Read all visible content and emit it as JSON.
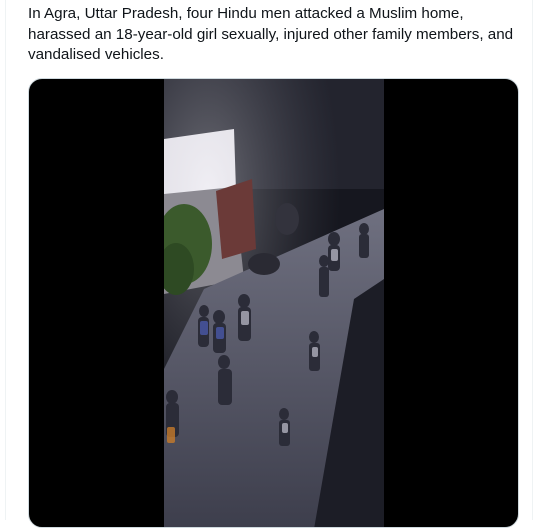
{
  "tweet": {
    "text": "In Agra, Uttar Pradesh, four Hindu men attacked a Muslim home, harassed an 18-year-old girl sexually, injured other family members, and vandalised vehicles."
  },
  "media": {
    "type": "video",
    "description_icon": "video-frame-icon",
    "colors": {
      "background": "#000000",
      "frame_dark": "#1a1b24",
      "ground": "#5f6070",
      "light_wall": "#eceaf0",
      "door": "#6b3a38"
    }
  }
}
